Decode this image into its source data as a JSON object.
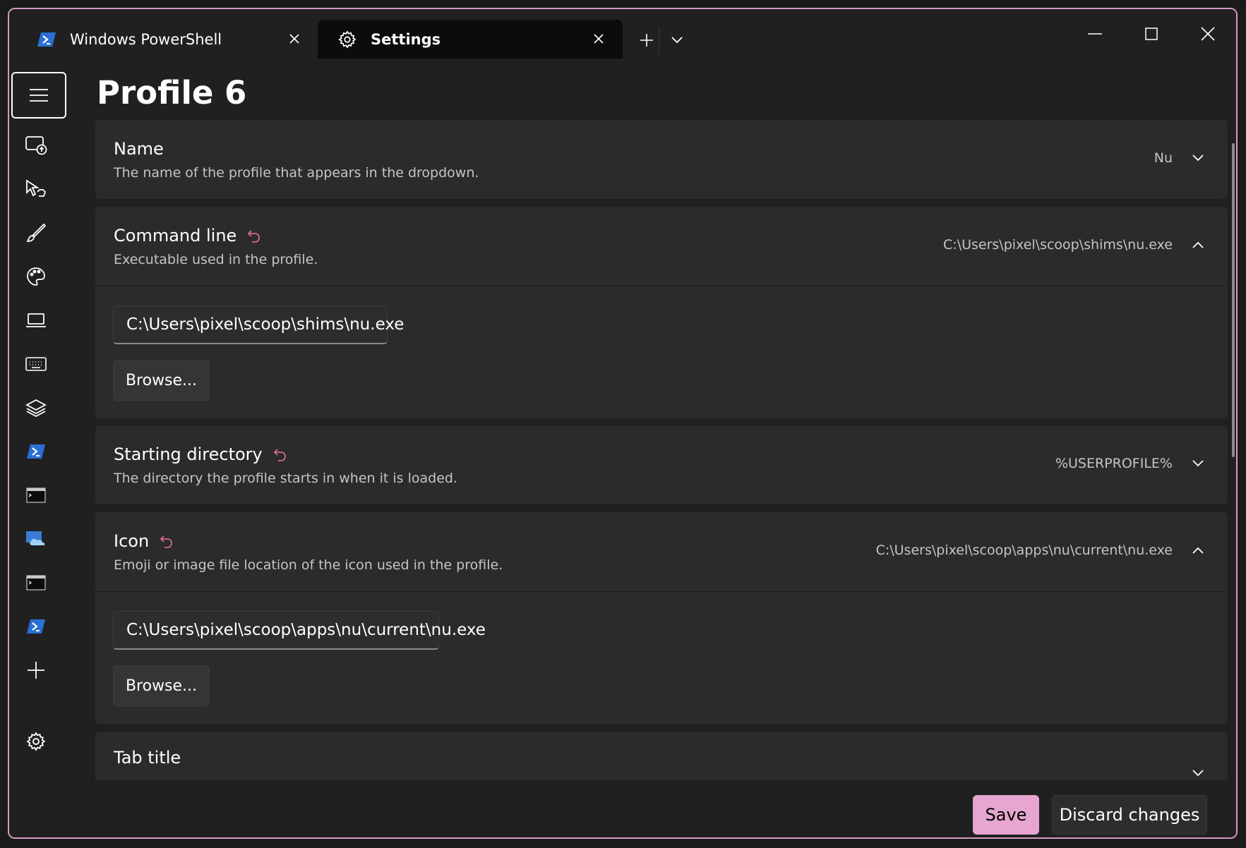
{
  "tabs": [
    {
      "label": "Windows PowerShell",
      "icon": "powershell-icon",
      "active": false
    },
    {
      "label": "Settings",
      "icon": "gear-icon",
      "active": true
    }
  ],
  "page": {
    "title": "Profile 6"
  },
  "settings": [
    {
      "title": "Name",
      "description": "The name of the profile that appears in the dropdown.",
      "value": "Nu",
      "expanded": false,
      "resettable": false
    },
    {
      "title": "Command line",
      "description": "Executable used in the profile.",
      "value": "C:\\Users\\pixel\\scoop\\shims\\nu.exe",
      "expanded": true,
      "resettable": true,
      "input_value": "C:\\Users\\pixel\\scoop\\shims\\nu.exe",
      "browse_label": "Browse..."
    },
    {
      "title": "Starting directory",
      "description": "The directory the profile starts in when it is loaded.",
      "value": "%USERPROFILE%",
      "expanded": false,
      "resettable": true
    },
    {
      "title": "Icon",
      "description": "Emoji or image file location of the icon used in the profile.",
      "value": "C:\\Users\\pixel\\scoop\\apps\\nu\\current\\nu.exe",
      "expanded": true,
      "resettable": true,
      "input_value": "C:\\Users\\pixel\\scoop\\apps\\nu\\current\\nu.exe",
      "browse_label": "Browse..."
    },
    {
      "title": "Tab title"
    }
  ],
  "footer": {
    "save_label": "Save",
    "discard_label": "Discard changes"
  },
  "colors": {
    "accent": "#e6a6cf",
    "reset_icon": "#d46b8e",
    "window_border": "#d39cc0",
    "powershell_blue": "#2a6fd6"
  }
}
